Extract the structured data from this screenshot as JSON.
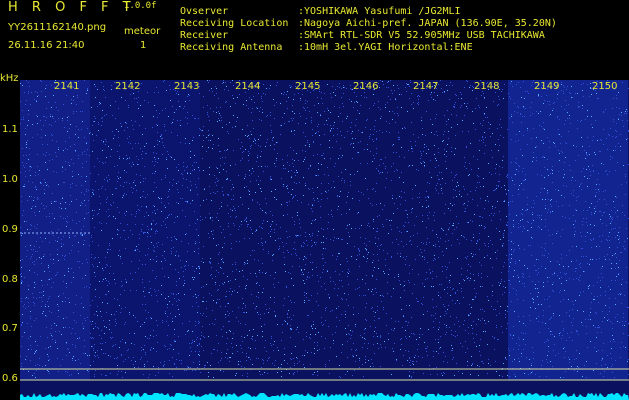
{
  "header": {
    "app_title": "H R O F F T",
    "version": "1.0.0f",
    "filename": "YY2611162140.png",
    "datetime": "26.11.16 21:40",
    "meteor_label": "meteor",
    "meteor_count": "1",
    "info": [
      {
        "label": "Ovserver",
        "value": ":YOSHIKAWA Yasufumi /JG2MLI"
      },
      {
        "label": "Receiving Location",
        "value": ":Nagoya Aichi-pref. JAPAN (136.90E, 35.20N)"
      },
      {
        "label": "Receiver",
        "value": ":SMArt RTL-SDR V5 52.905MHz USB TACHIKAWA"
      },
      {
        "label": "Receiving Antenna",
        "value": ":10mH 3el.YAGI Horizontal:ENE"
      }
    ]
  },
  "plot": {
    "y_unit": "kHz",
    "y_ticks": [
      "1.1",
      "1.0",
      "0.9",
      "0.8",
      "0.7",
      "0.6"
    ],
    "x_ticks": [
      "2141",
      "2142",
      "2143",
      "2144",
      "2145",
      "2146",
      "2147",
      "2148",
      "2149",
      "2150"
    ],
    "colors": {
      "noise": "#1a2aa0",
      "bright": "#5aa8ff",
      "signal": "#00e5ff",
      "text": "#e8e832"
    }
  }
}
